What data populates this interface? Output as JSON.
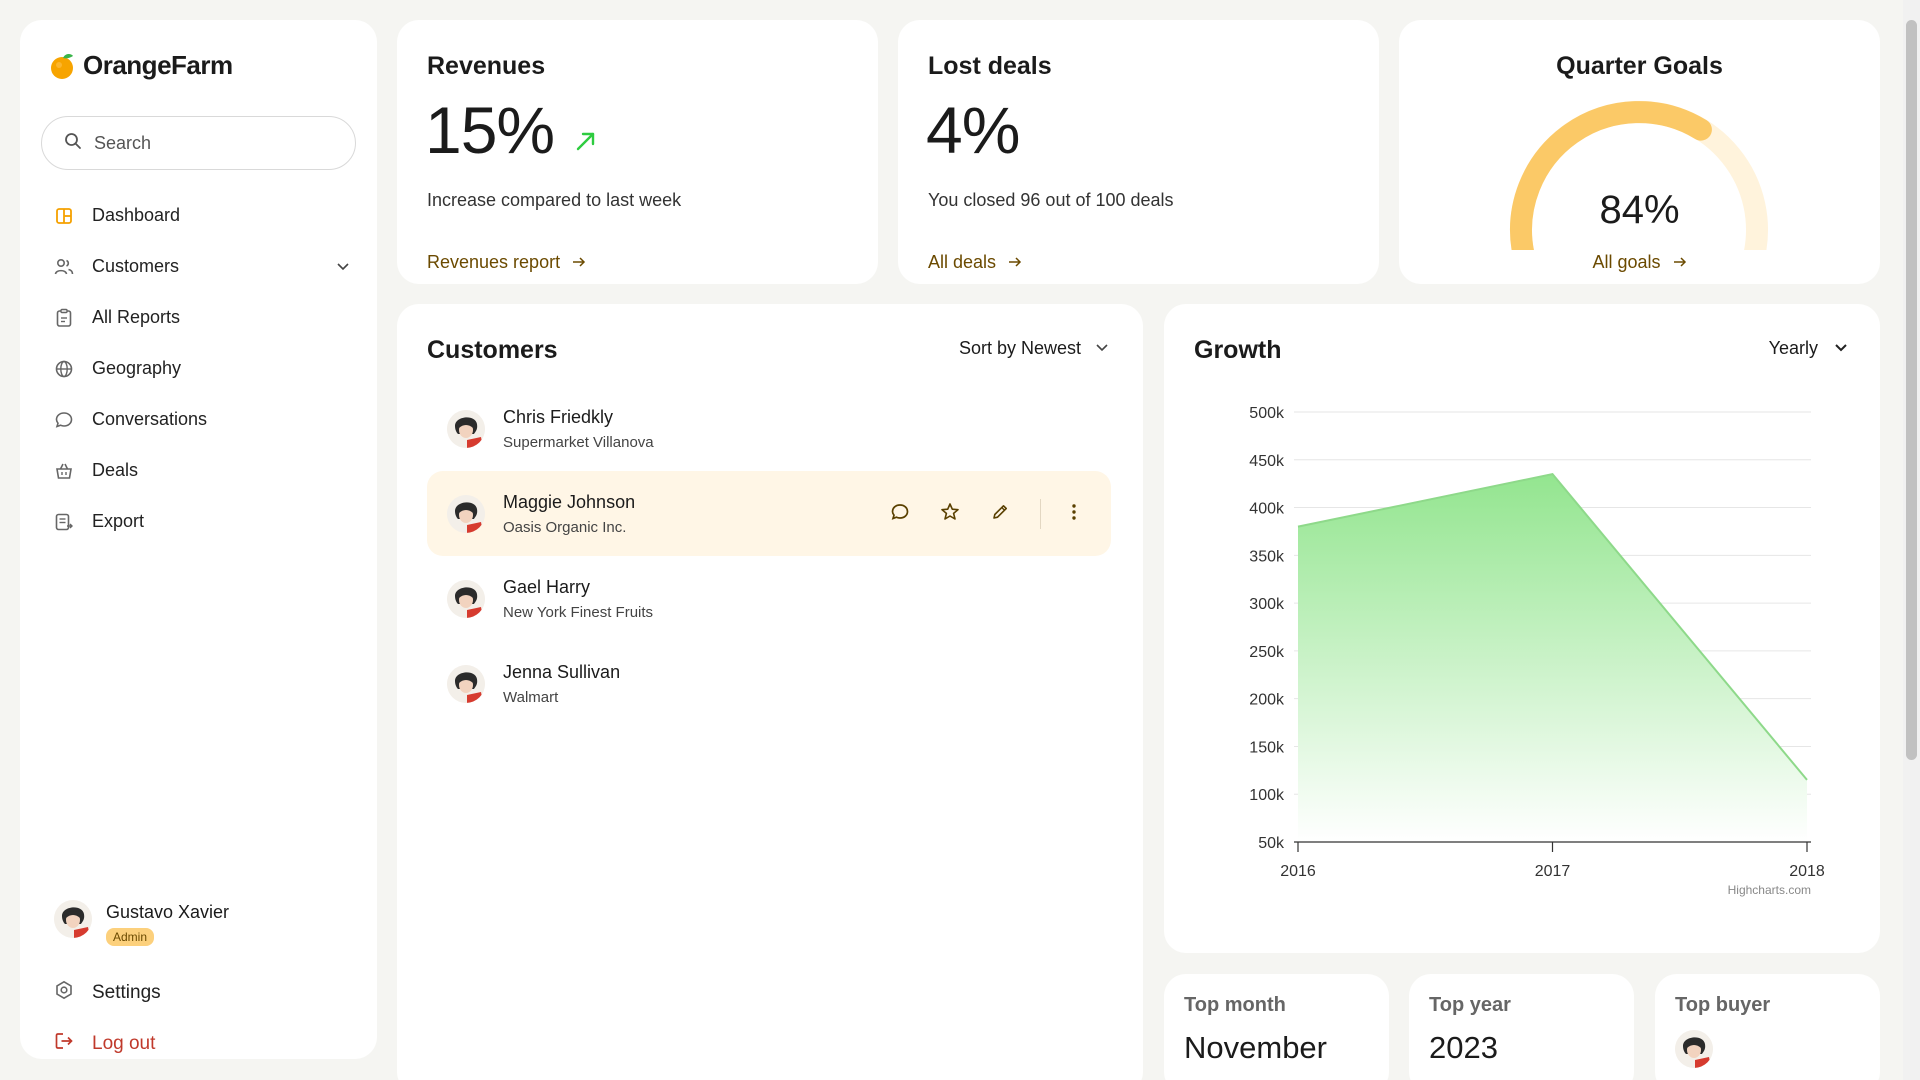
{
  "app": {
    "name": "OrangeFarm"
  },
  "search": {
    "placeholder": "Search"
  },
  "sidebar": {
    "items": [
      {
        "label": "Dashboard",
        "icon": "dashboard-icon"
      },
      {
        "label": "Customers",
        "icon": "users-icon"
      },
      {
        "label": "All Reports",
        "icon": "reports-icon"
      },
      {
        "label": "Geography",
        "icon": "globe-icon"
      },
      {
        "label": "Conversations",
        "icon": "chat-icon"
      },
      {
        "label": "Deals",
        "icon": "basket-icon"
      },
      {
        "label": "Export",
        "icon": "export-icon"
      }
    ],
    "user": {
      "name": "Gustavo Xavier",
      "role": "Admin"
    },
    "settings_label": "Settings",
    "logout_label": "Log out"
  },
  "revenues": {
    "title": "Revenues",
    "value": "15%",
    "subtitle": "Increase compared to last week",
    "link": "Revenues report"
  },
  "lost_deals": {
    "title": "Lost deals",
    "value": "4%",
    "subtitle": "You closed 96 out of 100 deals",
    "link": "All deals"
  },
  "quarter_goals": {
    "title": "Quarter Goals",
    "value": "84%",
    "progress": 0.84,
    "link": "All goals"
  },
  "customers": {
    "title": "Customers",
    "sort_label": "Sort by Newest",
    "rows": [
      {
        "name": "Chris Friedkly",
        "company": "Supermarket Villanova"
      },
      {
        "name": "Maggie Johnson",
        "company": "Oasis Organic Inc."
      },
      {
        "name": "Gael Harry",
        "company": "New York Finest Fruits"
      },
      {
        "name": "Jenna Sullivan",
        "company": "Walmart"
      }
    ]
  },
  "growth": {
    "title": "Growth",
    "period": "Yearly",
    "credit": "Highcharts.com"
  },
  "chart_data": {
    "type": "area",
    "x": [
      "2016",
      "2017",
      "2018"
    ],
    "series": [
      {
        "values": [
          380000,
          435000,
          115000
        ]
      }
    ],
    "y_ticks": [
      "50k",
      "100k",
      "150k",
      "200k",
      "250k",
      "300k",
      "350k",
      "400k",
      "450k",
      "500k"
    ],
    "ylim": [
      50000,
      500000
    ],
    "grid": true,
    "title": "",
    "colors": {
      "fill_top": "#93e58f",
      "fill_bottom": "#ffffff",
      "line": "#8ed98a"
    }
  },
  "stats": {
    "top_month": {
      "label": "Top month",
      "value": "November"
    },
    "top_year": {
      "label": "Top year",
      "value": "2023"
    },
    "top_buyer": {
      "label": "Top buyer"
    }
  },
  "colors": {
    "accent": "#f5a100",
    "link": "#6b4a00",
    "gauge": "#fbc967",
    "gauge_track": "#fff3dc",
    "logout": "#c0392b"
  }
}
